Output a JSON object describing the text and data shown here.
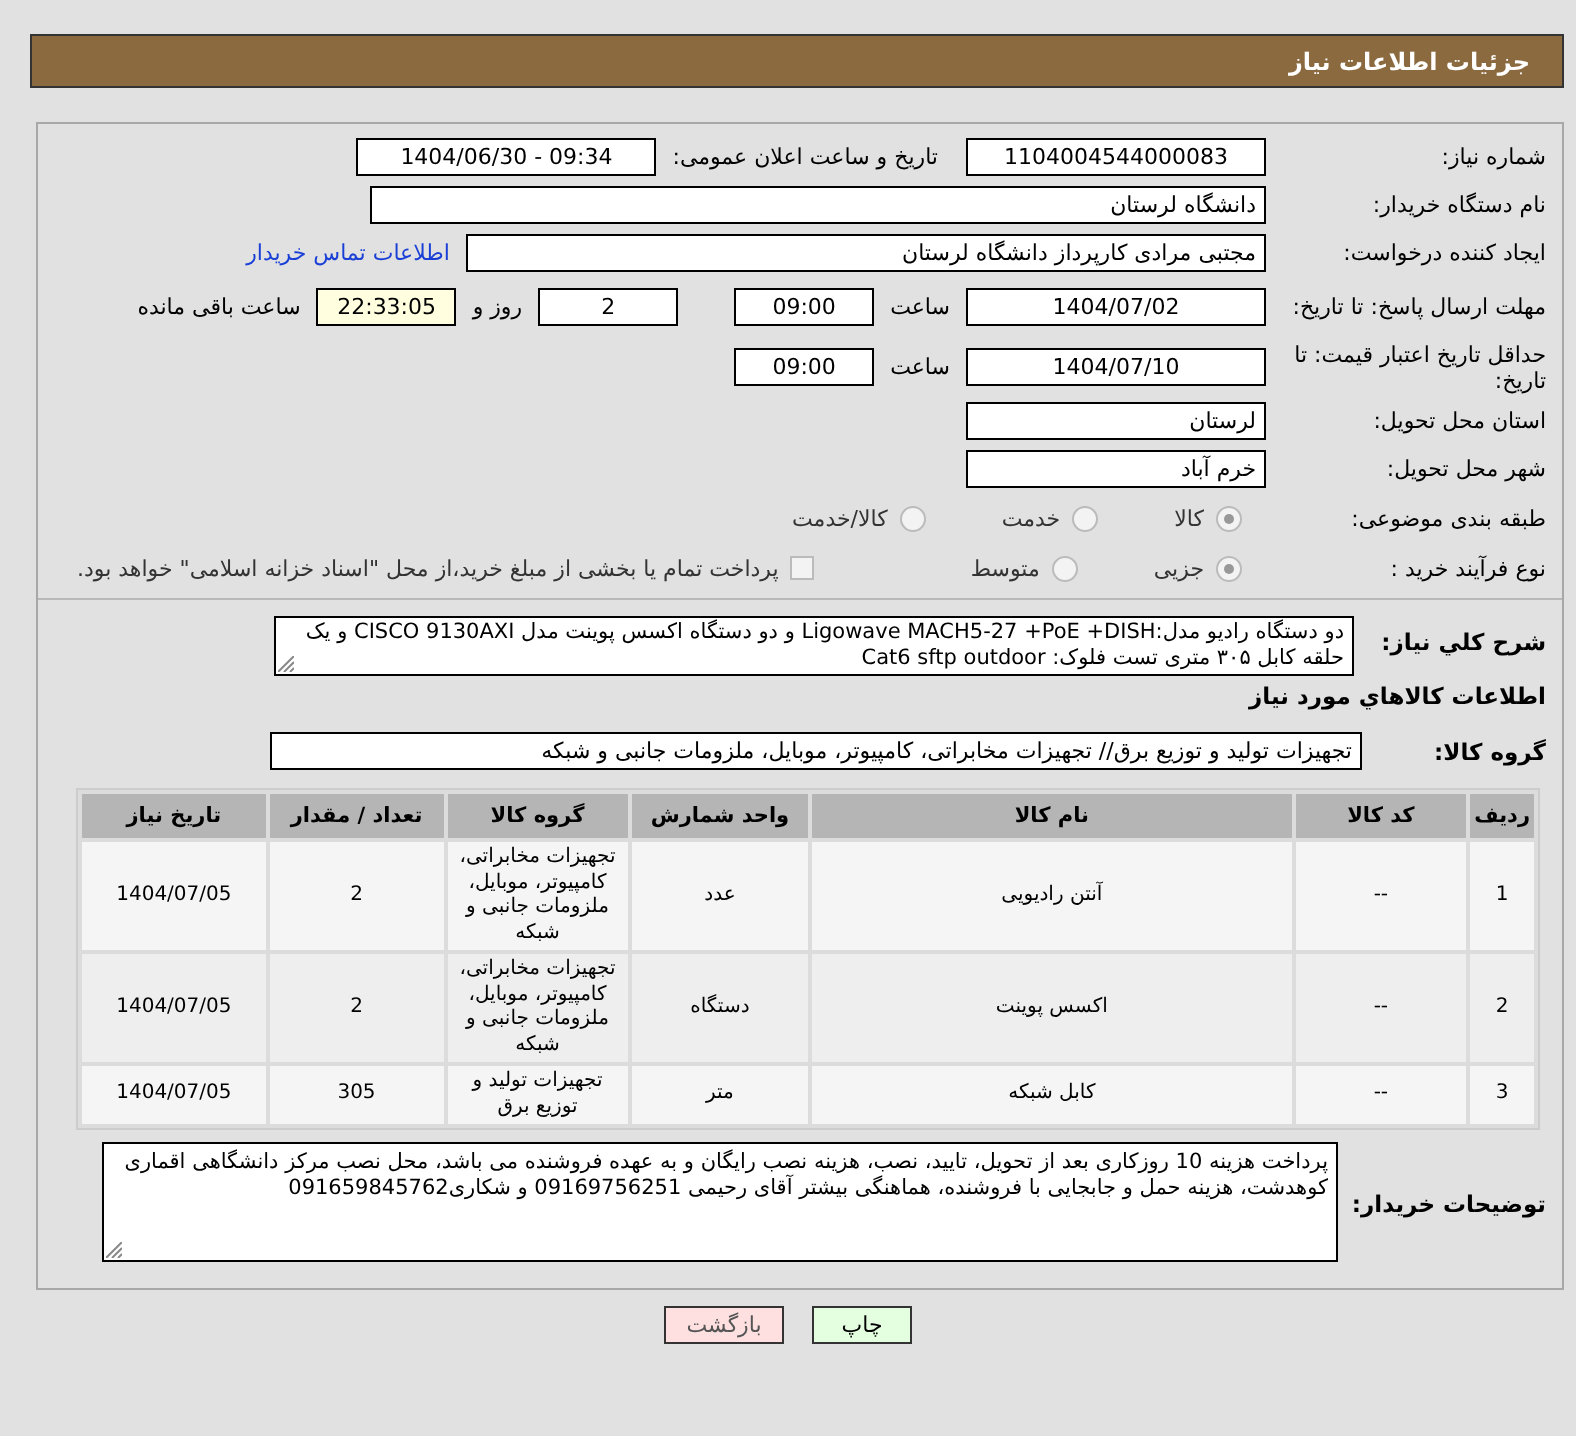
{
  "header": {
    "title": "جزئیات اطلاعات نیاز"
  },
  "need_number": {
    "label": "شماره نیاز:",
    "value": "1104004544000083"
  },
  "announce": {
    "label": "تاریخ و ساعت اعلان عمومی:",
    "value": "1404/06/30 - 09:34"
  },
  "buyer_org": {
    "label": "نام دستگاه خریدار:",
    "value": "دانشگاه لرستان"
  },
  "requester": {
    "label": "ایجاد کننده درخواست:",
    "value": "مجتبی مرادی کارپرداز دانشگاه لرستان",
    "link": "اطلاعات تماس خریدار"
  },
  "response_deadline": {
    "label": "مهلت ارسال پاسخ: تا تاریخ:",
    "date": "1404/07/02",
    "time_label": "ساعت",
    "time": "09:00",
    "days": "2",
    "days_label": "روز و",
    "remaining": "22:33:05",
    "remaining_label": "ساعت باقی مانده"
  },
  "price_validity": {
    "label": "حداقل تاریخ اعتبار قیمت: تا تاریخ:",
    "date": "1404/07/10",
    "time_label": "ساعت",
    "time": "09:00"
  },
  "province": {
    "label": "استان محل تحویل:",
    "value": "لرستان"
  },
  "city": {
    "label": "شهر محل تحویل:",
    "value": "خرم آباد"
  },
  "category": {
    "label": "طبقه بندی موضوعی:",
    "options": [
      {
        "label": "کالا",
        "selected": true
      },
      {
        "label": "خدمت",
        "selected": false
      },
      {
        "label": "کالا/خدمت",
        "selected": false
      }
    ]
  },
  "process": {
    "label": "نوع فرآیند خرید :",
    "options": [
      {
        "label": "جزیی",
        "selected": true
      },
      {
        "label": "متوسط",
        "selected": false
      }
    ],
    "payment_note": {
      "label": "پرداخت تمام یا بخشی از مبلغ خرید،از محل \"اسناد خزانه اسلامی\" خواهد بود.",
      "checked": false
    }
  },
  "description": {
    "label": "شرح کلي نياز:",
    "value": "دو دستگاه رادیو مدل:Ligowave MACH5-27 +PoE +DISH و دو دستگاه اکسس پوینت مدل CISCO 9130AXI و یک حلقه کابل ۳۰۵ متری تست فلوک: Cat6 sftp outdoor"
  },
  "items_heading": "اطلاعات کالاهاي مورد نياز",
  "goods_group": {
    "label": "گروه کالا:",
    "value": "تجهیزات تولید و توزیع برق// تجهیزات مخابراتی، کامپیوتر، موبایل، ملزومات جانبی و شبکه"
  },
  "table": {
    "columns": [
      "ردیف",
      "کد کالا",
      "نام کالا",
      "واحد شمارش",
      "گروه کالا",
      "تعداد / مقدار",
      "تاریخ نیاز"
    ],
    "rows": [
      [
        "1",
        "--",
        "آنتن رادیویی",
        "عدد",
        "تجهیزات مخابراتی، کامپیوتر، موبایل، ملزومات جانبی و شبکه",
        "2",
        "1404/07/05"
      ],
      [
        "2",
        "--",
        "اکسس پوینت",
        "دستگاه",
        "تجهیزات مخابراتی، کامپیوتر، موبایل، ملزومات جانبی و شبکه",
        "2",
        "1404/07/05"
      ],
      [
        "3",
        "--",
        "کابل شبکه",
        "متر",
        "تجهیزات تولید و توزیع برق",
        "305",
        "1404/07/05"
      ]
    ]
  },
  "buyer_notes": {
    "label": "توضیحات خریدار:",
    "value": "پرداخت هزینه 10 روزکاری بعد از تحویل، تایید، نصب، هزینه نصب رایگان و به عهده فروشنده می باشد، محل نصب مرکز دانشگاهی اقماری کوهدشت، هزینه حمل و جابجایی با فروشنده، هماهنگی بیشتر آقای رحیمی 09169756251 و شکاری091659845762"
  },
  "buttons": [
    {
      "label": "چاپ",
      "kind": "print"
    },
    {
      "label": "بازگشت",
      "kind": "back"
    }
  ]
}
